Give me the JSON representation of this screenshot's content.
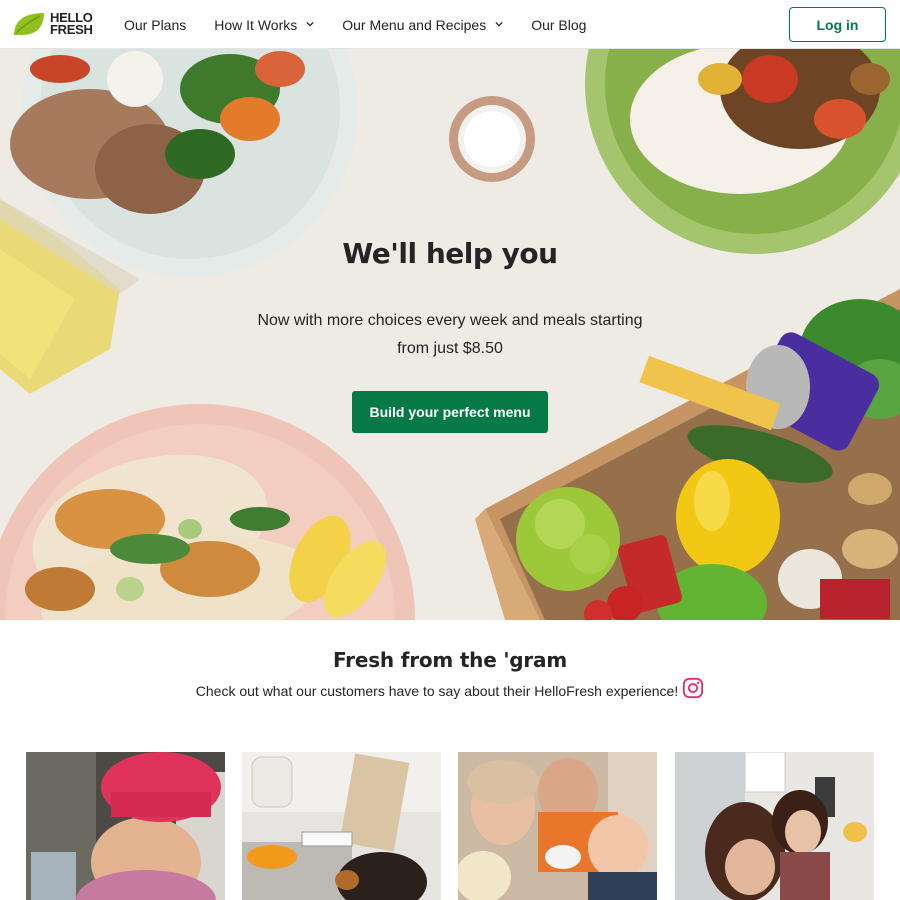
{
  "header": {
    "logo_line1": "HELLO",
    "logo_line2": "FRESH",
    "nav": [
      {
        "label": "Our Plans",
        "has_dropdown": false
      },
      {
        "label": "How It Works",
        "has_dropdown": true
      },
      {
        "label": "Our Menu and Recipes",
        "has_dropdown": true
      },
      {
        "label": "Our Blog",
        "has_dropdown": false
      }
    ],
    "login_label": "Log in"
  },
  "hero": {
    "title": "We'll help you",
    "subtitle": "Now with more choices every week and meals starting from just $8.50",
    "cta_label": "Build your perfect menu"
  },
  "gram": {
    "title": "Fresh from the 'gram",
    "subtitle": "Check out what our customers have to say about their HelloFresh experience!",
    "icon": "instagram-icon",
    "photos": [
      {
        "alt_icon": "photo-child-chef"
      },
      {
        "alt_icon": "photo-kitchen-dog"
      },
      {
        "alt_icon": "photo-family-selfie"
      },
      {
        "alt_icon": "photo-kids-kitchen"
      }
    ]
  },
  "colors": {
    "brand_green": "#067a46",
    "logo_green": "#91c11e",
    "text": "#242424",
    "hero_bg": "#eeebe4"
  }
}
